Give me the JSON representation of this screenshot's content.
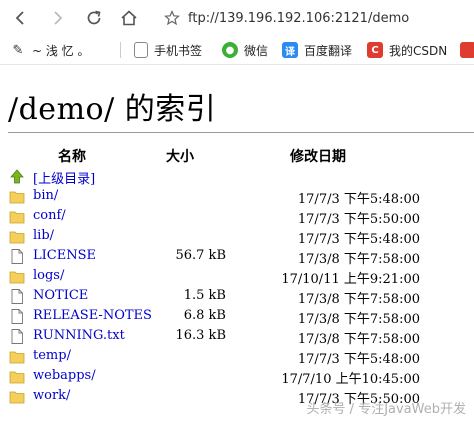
{
  "browser": {
    "url": "ftp://139.196.192.106:2121/demo",
    "bookmarks": [
      {
        "label": "~ 浅 忆 。",
        "icon": "ink-brush-icon",
        "color": "#444444"
      },
      {
        "label": "手机书签",
        "icon": "mobile-bookmark-icon",
        "color": "#555555"
      },
      {
        "label": "微信",
        "icon": "wechat-icon",
        "color": "#3cb034"
      },
      {
        "label": "百度翻译",
        "icon": "baidu-translate-icon",
        "color": "#2a8bf2"
      },
      {
        "label": "我的CSDN",
        "icon": "csdn-icon",
        "color": "#e03b2f"
      }
    ]
  },
  "page": {
    "title": "/demo/ 的索引",
    "columns": {
      "name": "名称",
      "size": "大小",
      "modified": "修改日期"
    },
    "parent_link": "[上级目录]",
    "entries": [
      {
        "name": "bin/",
        "type": "folder",
        "size": "",
        "date": "17/7/3",
        "time": "下午5:48:00"
      },
      {
        "name": "conf/",
        "type": "folder",
        "size": "",
        "date": "17/7/3",
        "time": "下午5:50:00"
      },
      {
        "name": "lib/",
        "type": "folder",
        "size": "",
        "date": "17/7/3",
        "time": "下午5:48:00"
      },
      {
        "name": "LICENSE",
        "type": "file",
        "size": "56.7 kB",
        "date": "17/3/8",
        "time": "下午7:58:00"
      },
      {
        "name": "logs/",
        "type": "folder",
        "size": "",
        "date": "17/10/11",
        "time": "上午9:21:00"
      },
      {
        "name": "NOTICE",
        "type": "file",
        "size": "1.5 kB",
        "date": "17/3/8",
        "time": "下午7:58:00"
      },
      {
        "name": "RELEASE-NOTES",
        "type": "file",
        "size": "6.8 kB",
        "date": "17/3/8",
        "time": "下午7:58:00"
      },
      {
        "name": "RUNNING.txt",
        "type": "file",
        "size": "16.3 kB",
        "date": "17/3/8",
        "time": "下午7:58:00"
      },
      {
        "name": "temp/",
        "type": "folder",
        "size": "",
        "date": "17/7/3",
        "time": "下午5:48:00"
      },
      {
        "name": "webapps/",
        "type": "folder",
        "size": "",
        "date": "17/7/10",
        "time": "上午10:45:00"
      },
      {
        "name": "work/",
        "type": "folder",
        "size": "",
        "date": "17/7/3",
        "time": "下午5:50:00"
      }
    ]
  },
  "watermark": "头条号 / 专注JavaWeb开发"
}
